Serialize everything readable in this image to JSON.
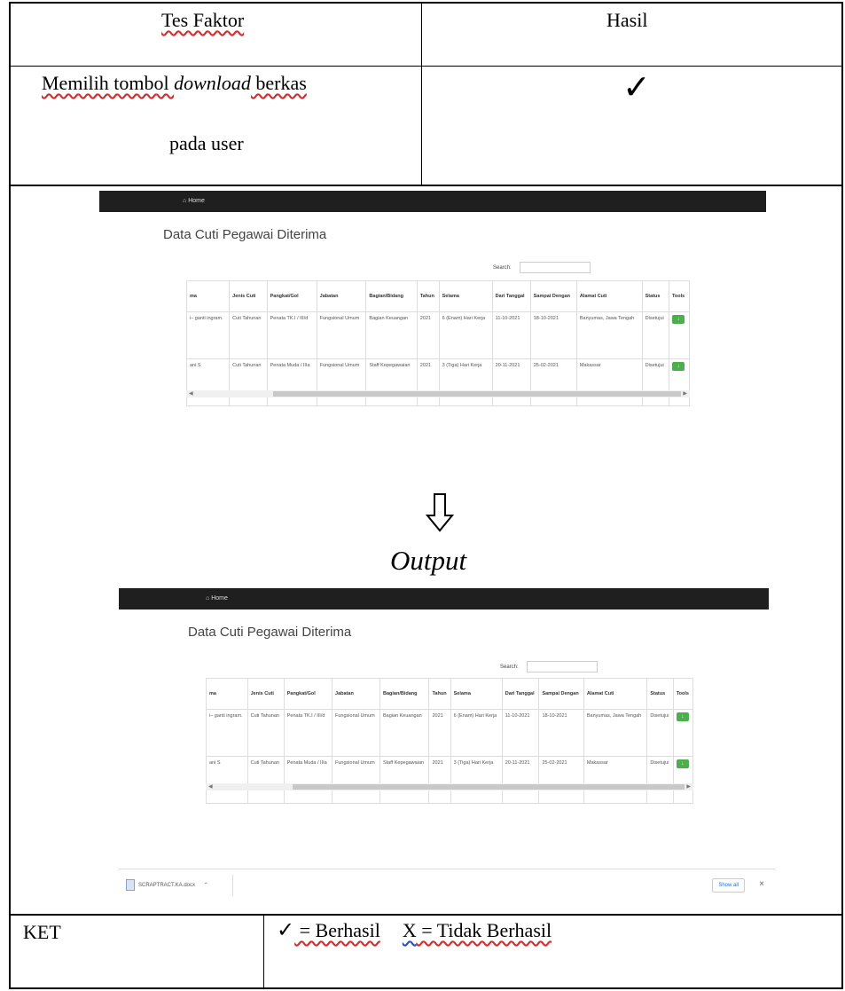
{
  "header": {
    "col_factor": "Tes Faktor",
    "col_result": "Hasil"
  },
  "row": {
    "factor_line1_a": "Memilih tombol ",
    "factor_line1_em": "download",
    "factor_line1_b": " berkas",
    "factor_line2": "pada user",
    "result_mark": "✓"
  },
  "output_label": "Output",
  "app": {
    "home_label": "Home",
    "page_title": "Data Cuti Pegawai Diterima",
    "search_label": "Search:",
    "columns": [
      "ma",
      "Jenis Cuti",
      "Pangkat/Gol",
      "Jabatan",
      "Bagian/Bidang",
      "Tahun",
      "Selama",
      "Dari Tanggal",
      "Sampai Dengan",
      "Alamat Cuti",
      "Status",
      "Tools"
    ],
    "rows": [
      [
        "i– ganti ingram.",
        "Cuti Tahunan",
        "Penata TK.I / III/d",
        "Fungsional Umum",
        "Bagian Keuangan",
        "2021",
        "6 (Enam) Hari Kerja",
        "11-10-2021",
        "18-10-2021",
        "Banyumas, Jawa Tengah",
        "Disetujui",
        "↓"
      ],
      [
        "ani S",
        "Cuti Tahunan",
        "Penata Muda / IIIa",
        "Fungsional Umum",
        "Staff Kepegawaian",
        "2021",
        "3 (Tiga) Hari Kerja",
        "20-11-2021",
        "25-02-2021",
        "Makassar",
        "Disetujui",
        "↓"
      ]
    ]
  },
  "download_bar": {
    "file_name": "SCRAPTRACT.KA.docx",
    "show_all": "Show all",
    "close": "×"
  },
  "legend": {
    "label": "KET",
    "check": "✓",
    "success_text": " = Berhasil",
    "x_mark": "X",
    "fail_text": " = Tidak Berhasil"
  }
}
